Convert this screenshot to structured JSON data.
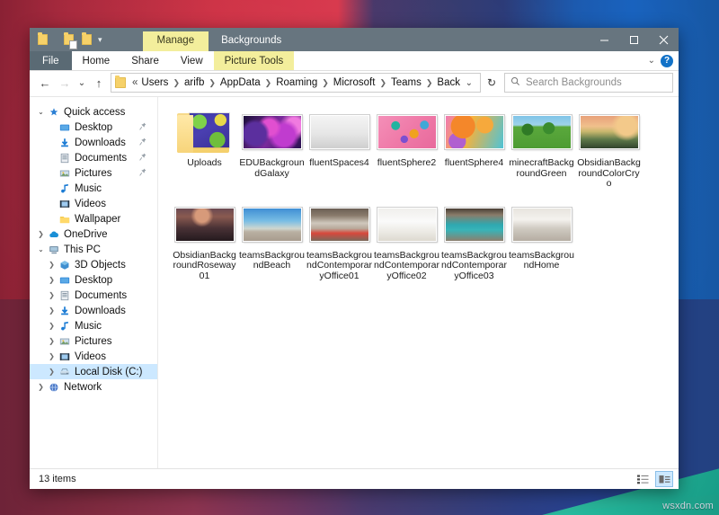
{
  "desktop": {
    "watermark": "wsxdn.com"
  },
  "window": {
    "context_tab": "Manage",
    "title": "Backgrounds",
    "quick_access": [
      {
        "name": "folder-properties-icon",
        "label": "Properties"
      },
      {
        "name": "folder-new-icon",
        "label": "New folder"
      },
      {
        "name": "customize-qat-dropdown",
        "label": "▾"
      }
    ],
    "controls": {
      "minimize": "Minimize",
      "maximize": "Maximize",
      "close": "Close"
    },
    "ribbon_tabs": [
      {
        "label": "File",
        "type": "file"
      },
      {
        "label": "Home",
        "type": "normal"
      },
      {
        "label": "Share",
        "type": "normal"
      },
      {
        "label": "View",
        "type": "normal"
      },
      {
        "label": "Picture Tools",
        "type": "context"
      }
    ],
    "ribbon_collapse": "⌄",
    "help_label": "?"
  },
  "address": {
    "back": "←",
    "forward": "→",
    "recent": "⌄",
    "up": "↑",
    "overflow": "«",
    "crumbs": [
      "Users",
      "arifb",
      "AppData",
      "Roaming",
      "Microsoft",
      "Teams",
      "Backgrounds"
    ],
    "dropdown": "⌄",
    "refresh": "↻",
    "search_icon": "search-icon",
    "search_placeholder": "Search Backgrounds"
  },
  "nav_pane": {
    "items": [
      {
        "label": "Quick access",
        "icon": "star-pin-icon",
        "indent": 0,
        "twisty": "open",
        "pinned": false,
        "selected": false
      },
      {
        "label": "Desktop",
        "icon": "desktop-icon",
        "indent": 1,
        "twisty": "none",
        "pinned": true,
        "selected": false
      },
      {
        "label": "Downloads",
        "icon": "downloads-icon",
        "indent": 1,
        "twisty": "none",
        "pinned": true,
        "selected": false
      },
      {
        "label": "Documents",
        "icon": "documents-icon",
        "indent": 1,
        "twisty": "none",
        "pinned": true,
        "selected": false
      },
      {
        "label": "Pictures",
        "icon": "pictures-icon",
        "indent": 1,
        "twisty": "none",
        "pinned": true,
        "selected": false
      },
      {
        "label": "Music",
        "icon": "music-icon",
        "indent": 1,
        "twisty": "none",
        "pinned": false,
        "selected": false
      },
      {
        "label": "Videos",
        "icon": "videos-icon",
        "indent": 1,
        "twisty": "none",
        "pinned": false,
        "selected": false
      },
      {
        "label": "Wallpaper",
        "icon": "folder-icon",
        "indent": 1,
        "twisty": "none",
        "pinned": false,
        "selected": false
      },
      {
        "label": "OneDrive",
        "icon": "onedrive-cloud-icon",
        "indent": 0,
        "twisty": "closed",
        "pinned": false,
        "selected": false
      },
      {
        "label": "This PC",
        "icon": "this-pc-icon",
        "indent": 0,
        "twisty": "open",
        "pinned": false,
        "selected": false
      },
      {
        "label": "3D Objects",
        "icon": "3d-objects-icon",
        "indent": 1,
        "twisty": "closed",
        "pinned": false,
        "selected": false
      },
      {
        "label": "Desktop",
        "icon": "desktop-icon",
        "indent": 1,
        "twisty": "closed",
        "pinned": false,
        "selected": false
      },
      {
        "label": "Documents",
        "icon": "documents-icon",
        "indent": 1,
        "twisty": "closed",
        "pinned": false,
        "selected": false
      },
      {
        "label": "Downloads",
        "icon": "downloads-icon",
        "indent": 1,
        "twisty": "closed",
        "pinned": false,
        "selected": false
      },
      {
        "label": "Music",
        "icon": "music-icon",
        "indent": 1,
        "twisty": "closed",
        "pinned": false,
        "selected": false
      },
      {
        "label": "Pictures",
        "icon": "pictures-icon",
        "indent": 1,
        "twisty": "closed",
        "pinned": false,
        "selected": false
      },
      {
        "label": "Videos",
        "icon": "videos-icon",
        "indent": 1,
        "twisty": "closed",
        "pinned": false,
        "selected": false
      },
      {
        "label": "Local Disk (C:)",
        "icon": "hard-drive-icon",
        "indent": 1,
        "twisty": "closed",
        "pinned": false,
        "selected": true
      },
      {
        "label": "Network",
        "icon": "network-icon",
        "indent": 0,
        "twisty": "closed",
        "pinned": false,
        "selected": false
      }
    ]
  },
  "files": [
    {
      "name": "Uploads",
      "type": "folder",
      "thumb": "galaxy-green-purple"
    },
    {
      "name": "EDUBackgroundGalaxy",
      "type": "image",
      "thumb": "nebula-magenta"
    },
    {
      "name": "fluentSpaces4",
      "type": "image",
      "thumb": "white-room"
    },
    {
      "name": "fluentSphere2",
      "type": "image",
      "thumb": "pink-spheres"
    },
    {
      "name": "fluentSphere4",
      "type": "image",
      "thumb": "orange-spheres"
    },
    {
      "name": "minecraftBackgroundGreen",
      "type": "image",
      "thumb": "minecraft-green"
    },
    {
      "name": "ObsidianBackgroundColorCryo",
      "type": "image",
      "thumb": "obsidian-cryo"
    },
    {
      "name": "ObsidianBackgroundRoseway01",
      "type": "image",
      "thumb": "obsidian-roseway"
    },
    {
      "name": "teamsBackgroundBeach",
      "type": "image",
      "thumb": "beach"
    },
    {
      "name": "teamsBackgroundContemporaryOffice01",
      "type": "image",
      "thumb": "office1"
    },
    {
      "name": "teamsBackgroundContemporaryOffice02",
      "type": "image",
      "thumb": "office2"
    },
    {
      "name": "teamsBackgroundContemporaryOffice03",
      "type": "image",
      "thumb": "office3"
    },
    {
      "name": "teamsBackgroundHome",
      "type": "image",
      "thumb": "home"
    }
  ],
  "status": {
    "item_count": "13 items",
    "view_details": "☷",
    "view_large_icons": "▤"
  },
  "colors": {
    "titlebar": "#67757f",
    "context_tab": "#f3ee9c",
    "selection": "#cce8ff",
    "help_blue": "#1272c8"
  }
}
